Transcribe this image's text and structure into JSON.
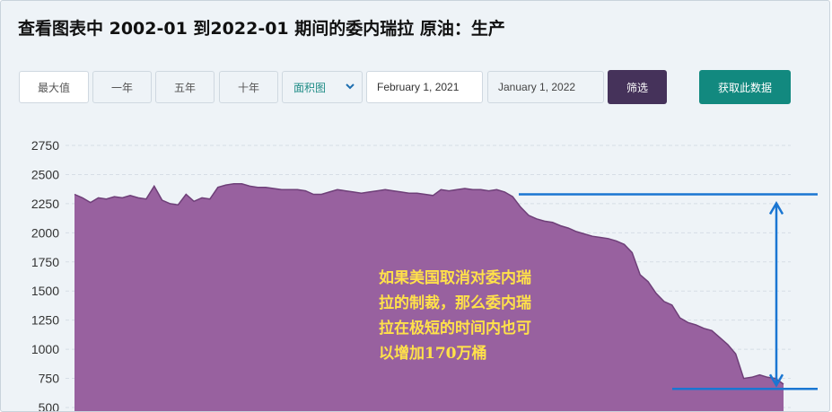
{
  "title": "查看图表中 2002-01 到2022-01 期间的委内瑞拉 原油：生产",
  "toolbar": {
    "max_label": "最大值",
    "one_year_label": "一年",
    "five_year_label": "五年",
    "ten_year_label": "十年",
    "chart_type_selected": "面积图",
    "start_date": "February 1, 2021",
    "end_date": "January 1, 2022",
    "filter_label": "筛选",
    "fetch_label": "获取此数据"
  },
  "colors": {
    "area_fill": "#98619f",
    "area_stroke": "#6e3f78",
    "marker_blue": "#1a76d2",
    "annotation_text": "#ffe14a",
    "filter_button": "#45325a",
    "fetch_button": "#12897f"
  },
  "annotation": {
    "lines": [
      "如果美国取消对委内瑞",
      "拉的制裁，那么委内瑞",
      "拉在极短的时间内也可",
      "以增加170万桶"
    ]
  },
  "chart_data": {
    "type": "area",
    "x_range": [
      "2002-01",
      "2022-01"
    ],
    "ylim": [
      500,
      2750
    ],
    "y_ticks": [
      500,
      750,
      1000,
      1250,
      1500,
      1750,
      2000,
      2250,
      2500,
      2750
    ],
    "grid": true,
    "values": [
      2330,
      2300,
      2260,
      2300,
      2290,
      2310,
      2300,
      2320,
      2300,
      2290,
      2400,
      2280,
      2250,
      2240,
      2330,
      2270,
      2300,
      2290,
      2390,
      2410,
      2420,
      2420,
      2400,
      2390,
      2390,
      2380,
      2370,
      2370,
      2370,
      2360,
      2330,
      2330,
      2350,
      2370,
      2360,
      2350,
      2340,
      2350,
      2360,
      2370,
      2360,
      2350,
      2340,
      2340,
      2330,
      2320,
      2370,
      2360,
      2370,
      2380,
      2370,
      2370,
      2360,
      2370,
      2350,
      2310,
      2220,
      2150,
      2120,
      2100,
      2090,
      2060,
      2040,
      2010,
      1990,
      1970,
      1960,
      1950,
      1930,
      1900,
      1830,
      1640,
      1580,
      1480,
      1410,
      1380,
      1270,
      1230,
      1210,
      1180,
      1160,
      1100,
      1040,
      960,
      750,
      760,
      780,
      760,
      750,
      700
    ],
    "annotations": {
      "upper_level": 2330,
      "lower_level": 660
    }
  }
}
